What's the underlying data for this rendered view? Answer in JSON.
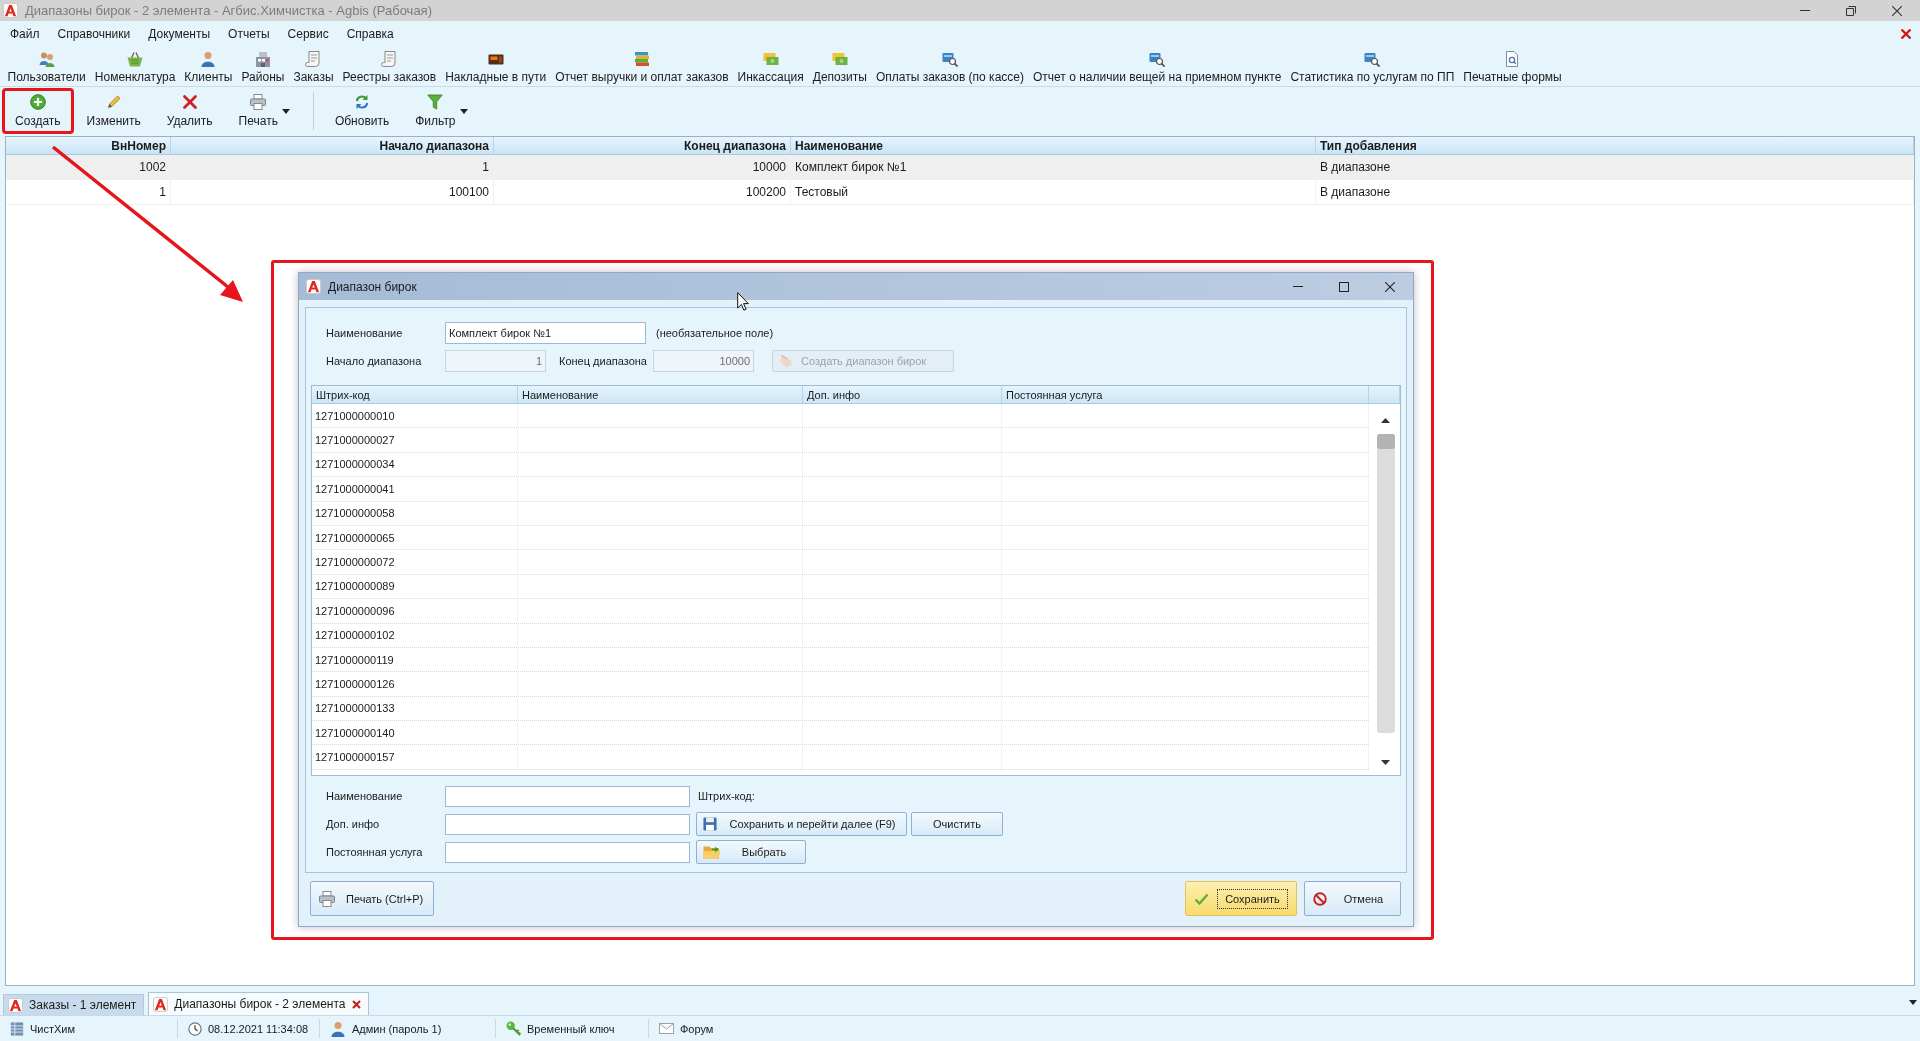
{
  "window": {
    "title": "Диапазоны бирок - 2 элемента - Агбис.Химчистка - Agbis (Рабочая)"
  },
  "menu": [
    "Файл",
    "Справочники",
    "Документы",
    "Отчеты",
    "Сервис",
    "Справка"
  ],
  "quick_launch": [
    "Пользователи",
    "Номенклатура",
    "Клиенты",
    "Районы",
    "Заказы",
    "Реестры заказов",
    "Накладные в пути",
    "Отчет выручки и оплат заказов",
    "Инкассация",
    "Депозиты",
    "Оплаты заказов (по кассе)",
    "Отчет о наличии вещей на приемном пункте",
    "Статистика по услугам по ПП",
    "Печатные формы"
  ],
  "toolbar": {
    "groups": [
      {
        "items": [
          {
            "kind": "create",
            "label": "Создать",
            "highlighted": true,
            "dropdown": false
          },
          {
            "kind": "edit",
            "label": "Изменить",
            "highlighted": false,
            "dropdown": false
          },
          {
            "kind": "delete",
            "label": "Удалить",
            "highlighted": false,
            "dropdown": false
          },
          {
            "kind": "print",
            "label": "Печать",
            "highlighted": false,
            "dropdown": true
          }
        ]
      },
      {
        "items": [
          {
            "kind": "refresh",
            "label": "Обновить",
            "highlighted": false,
            "dropdown": false
          },
          {
            "kind": "filter",
            "label": "Фильтр",
            "highlighted": false,
            "dropdown": true
          }
        ]
      }
    ]
  },
  "table": {
    "columns": [
      {
        "label": "ВнНомер",
        "kind": "number"
      },
      {
        "label": "Начало диапазона",
        "kind": "number"
      },
      {
        "label": "Конец диапазона",
        "kind": "number"
      },
      {
        "label": "Наименование",
        "kind": "text"
      },
      {
        "label": "Тип добавления",
        "kind": "text"
      }
    ],
    "rows": [
      {
        "selected": true,
        "cells": [
          "1002",
          "1",
          "10000",
          "Комплект бирок №1",
          "В диапазоне"
        ]
      },
      {
        "selected": false,
        "cells": [
          "1",
          "100100",
          "100200",
          "Тестовый",
          "В диапазоне"
        ]
      }
    ]
  },
  "dialog": {
    "title": "Диапазон бирок",
    "highlighted": true,
    "name_field": {
      "label": "Наименование",
      "value": "Комплект бирок №1",
      "note": "(необязательное поле)"
    },
    "range": {
      "start": {
        "label": "Начало диапазона",
        "value": "1",
        "disabled": true
      },
      "end": {
        "label": "Конец диапазона",
        "value": "10000",
        "disabled": true
      },
      "create_button": {
        "label": "Создать диапазон бирок",
        "disabled": true
      }
    },
    "grid": {
      "columns": [
        "Штрих-код",
        "Наименование",
        "Доп. инфо",
        "Постоянная услуга"
      ],
      "rows": [
        "1271000000010",
        "1271000000027",
        "1271000000034",
        "1271000000041",
        "1271000000058",
        "1271000000065",
        "1271000000072",
        "1271000000089",
        "1271000000096",
        "1271000000102",
        "1271000000119",
        "1271000000126",
        "1271000000133",
        "1271000000140",
        "1271000000157"
      ]
    },
    "editor": {
      "rows": [
        {
          "label": "Наименование",
          "extras": [
            {
              "kind": "text",
              "label": "Штрих-код:"
            }
          ]
        },
        {
          "label": "Доп. инфо",
          "extras": [
            {
              "kind": "save",
              "label": "Сохранить и перейти далее (F9)"
            },
            {
              "kind": "clear",
              "label": "Очистить"
            }
          ]
        },
        {
          "label": "Постоянная услуга",
          "extras": [
            {
              "kind": "pick",
              "label": "Выбрать"
            }
          ]
        }
      ]
    },
    "footer": [
      {
        "kind": "print",
        "label": "Печать (Ctrl+P)",
        "focused": false
      },
      {
        "kind": "save",
        "label": "Сохранить",
        "focused": true
      },
      {
        "kind": "cancel",
        "label": "Отмена",
        "focused": false
      }
    ]
  },
  "tabs": [
    {
      "label": "Заказы - 1 элемент",
      "selected": false
    },
    {
      "label": "Диапазоны бирок - 2 элемента",
      "selected": true
    }
  ],
  "status_bar": [
    {
      "kind": "company",
      "text": "ЧистХим"
    },
    {
      "kind": "datetime",
      "text": "08.12.2021 11:34:08"
    },
    {
      "kind": "user",
      "text": "Админ (пароль 1)"
    },
    {
      "kind": "license",
      "text": "Временный ключ"
    },
    {
      "kind": "forum",
      "text": "Форум"
    }
  ]
}
